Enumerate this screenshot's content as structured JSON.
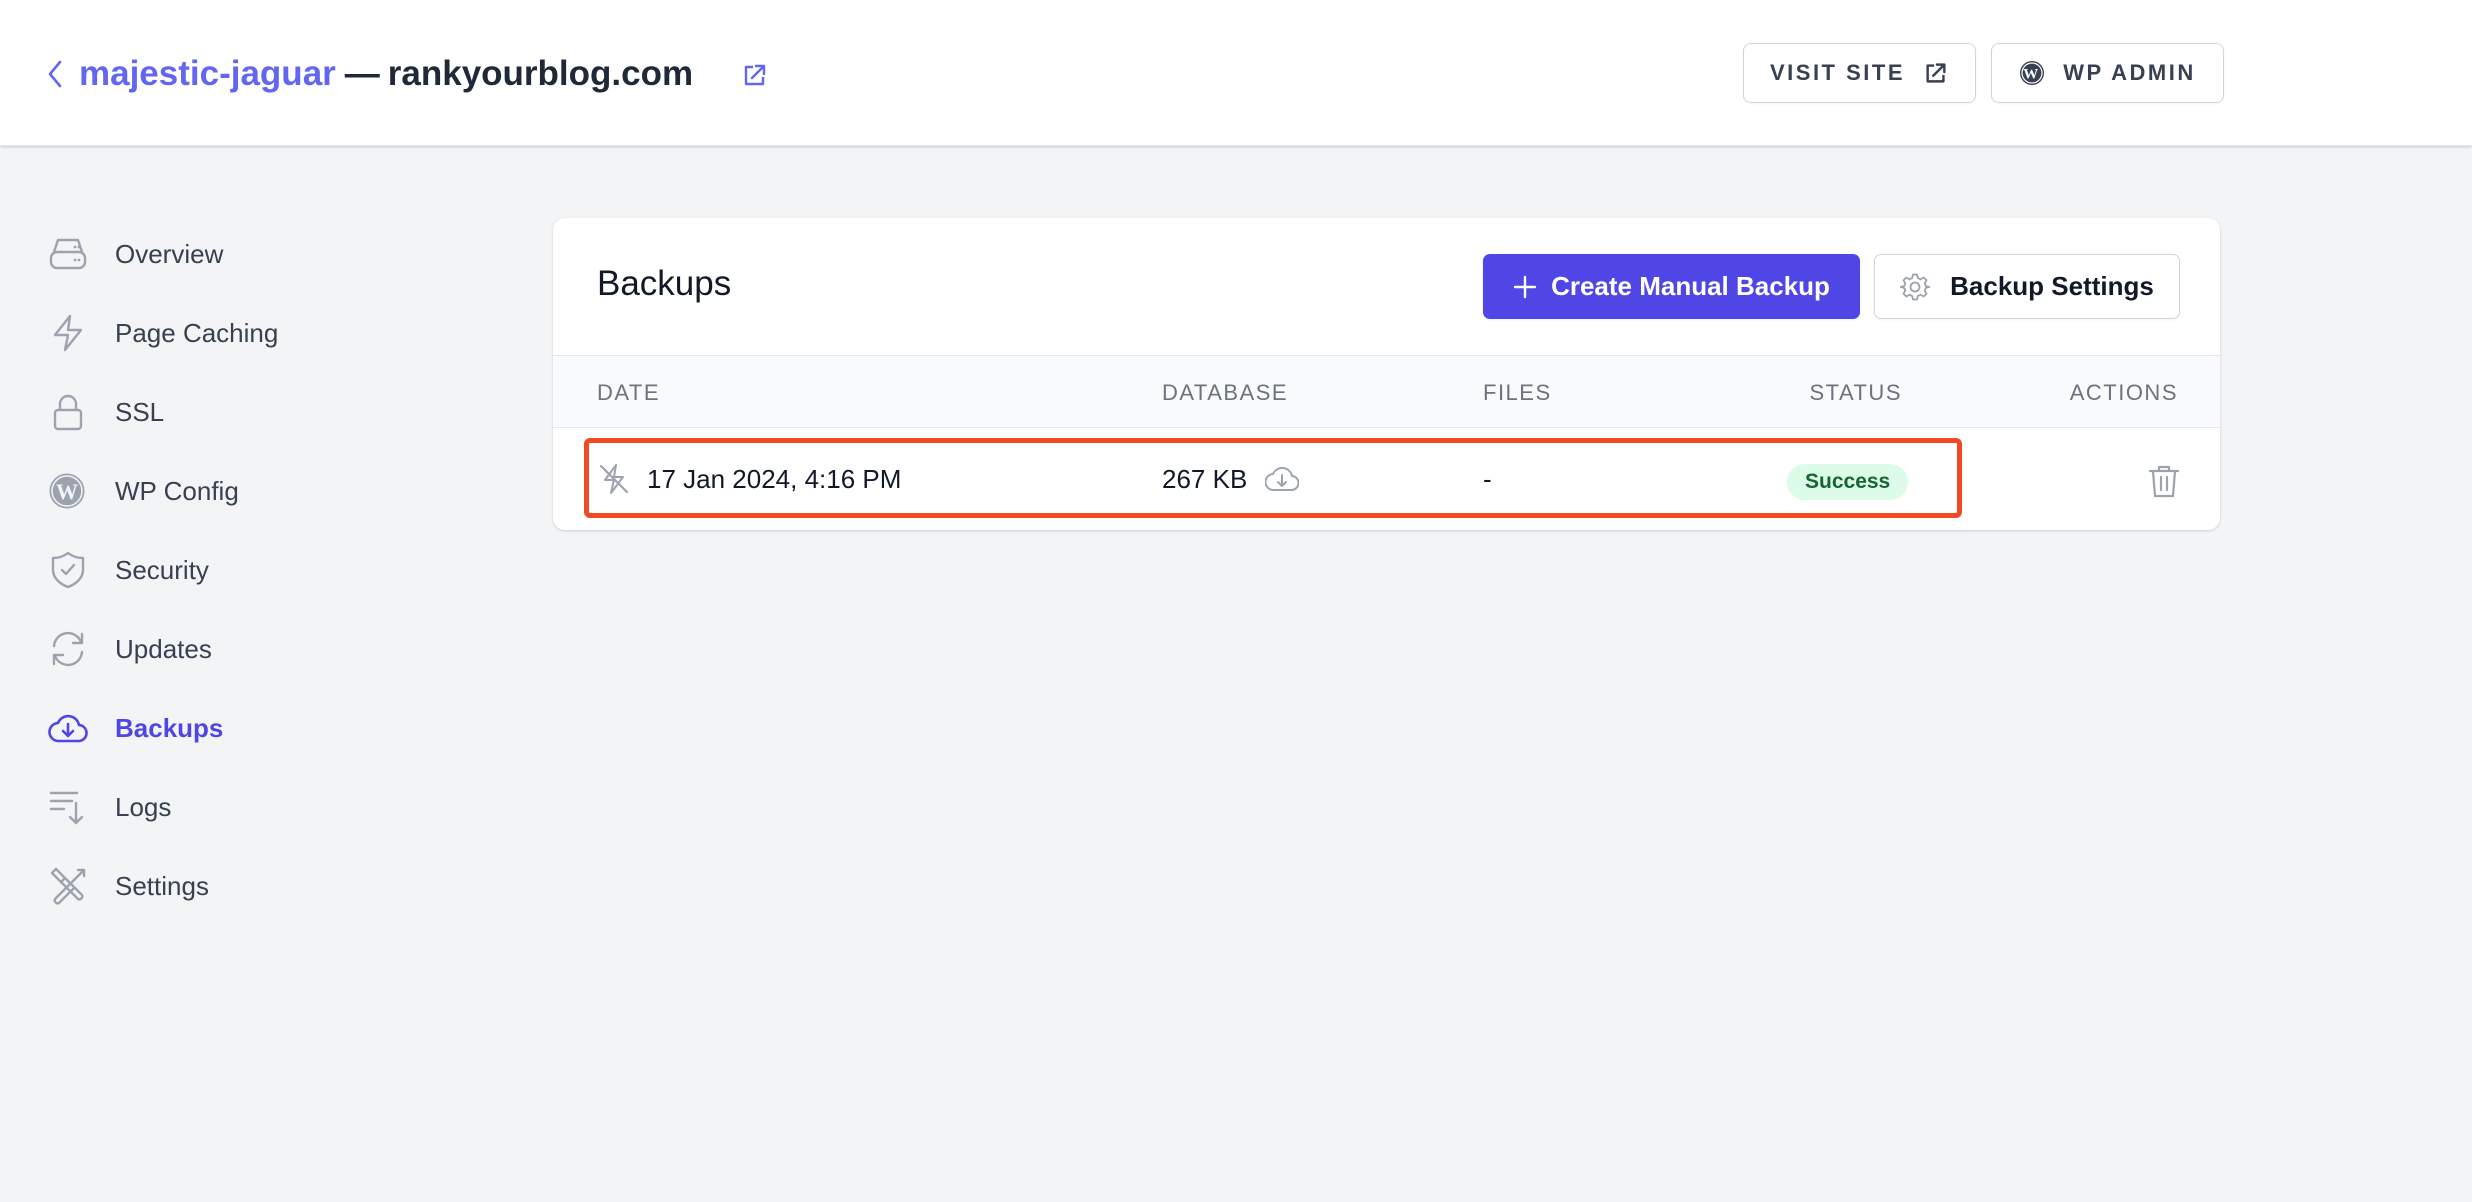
{
  "header": {
    "site_name": "majestic-jaguar",
    "separator": "—",
    "domain": "rankyourblog.com",
    "visit_site_label": "VISIT SITE",
    "wp_admin_label": "WP ADMIN"
  },
  "sidebar": {
    "active": "Backups",
    "items": [
      {
        "label": "Overview",
        "icon": "server-icon"
      },
      {
        "label": "Page Caching",
        "icon": "bolt-icon"
      },
      {
        "label": "SSL",
        "icon": "lock-icon"
      },
      {
        "label": "WP Config",
        "icon": "wordpress-icon"
      },
      {
        "label": "Security",
        "icon": "shield-check-icon"
      },
      {
        "label": "Updates",
        "icon": "refresh-icon"
      },
      {
        "label": "Backups",
        "icon": "cloud-download-icon"
      },
      {
        "label": "Logs",
        "icon": "list-arrow-down-icon"
      },
      {
        "label": "Settings",
        "icon": "wrench-screwdriver-icon"
      }
    ]
  },
  "backups": {
    "title": "Backups",
    "create_label": "Create Manual Backup",
    "settings_label": "Backup Settings",
    "columns": [
      "DATE",
      "DATABASE",
      "FILES",
      "STATUS",
      "ACTIONS"
    ],
    "rows": [
      {
        "type_icon": "bolt-slash-icon",
        "date": "17 Jan 2024, 4:16 PM",
        "database": "267 KB",
        "files": "-",
        "status": "Success"
      }
    ]
  },
  "colors": {
    "accent": "#4f46e5",
    "site_link": "#6366f1",
    "success_bg": "#dcfce7",
    "success_text": "#166534",
    "highlight": "#f04a24"
  }
}
